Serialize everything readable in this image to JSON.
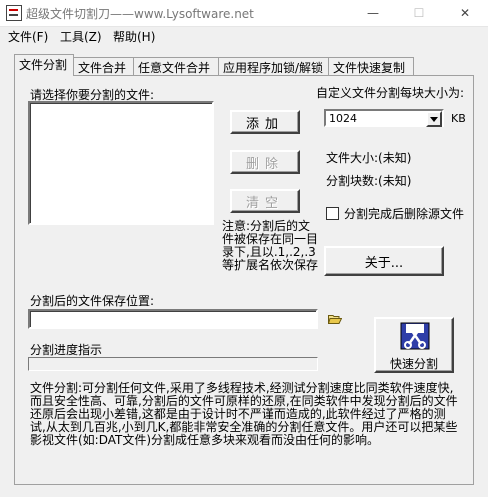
{
  "window": {
    "title": "超级文件切割刀——www.Lysoftware.net",
    "minimize_glyph": "—",
    "maximize_glyph": "☐",
    "close_glyph": "✕"
  },
  "menu": [
    "文件(F)",
    "工具(Z)",
    "帮助(H)"
  ],
  "tabs": [
    "文件分割",
    "文件合并",
    "任意文件合并",
    "应用程序加锁/解锁",
    "文件快速复制"
  ],
  "split": {
    "select_label": "请选择你要分割的文件:",
    "add_button": "添加",
    "delete_button": "删除",
    "clear_button": "清空",
    "note": "注意:分割后的文件被保存在同一目录下,且以.1,.2,.3等扩展名依次保存",
    "chunk_size_label": "自定义文件分割每块大小为:",
    "chunk_size_value": "1024",
    "chunk_unit": "KB",
    "file_size_label": "文件大小:(未知)",
    "chunk_count_label": "分割块数:(未知)",
    "delete_source_label": "分割完成后删除源文件",
    "delete_source_checked": false,
    "about_button": "关于...",
    "save_location_label": "分割后的文件保存位置:",
    "save_location_value": "",
    "progress_label": "分割进度指示",
    "progress_value": 0,
    "quick_split_button": "快速分割",
    "description": "文件分割:可分割任何文件,采用了多线程技术,经测试分割速度比同类软件速度快,而且安全性高、可靠,分割后的文件可原样的还原,在同类软件中发现分割后的文件还原后会出现小差错,这都是由于设计时不严谨而造成的,此软件经过了严格的测试,从太到几百兆,小到几K,都能非常安全准确的分割任意文件。用户还可以把某些影视文件(如:DAT文件)分割成任意多块来观看而没由任何的影响。"
  }
}
